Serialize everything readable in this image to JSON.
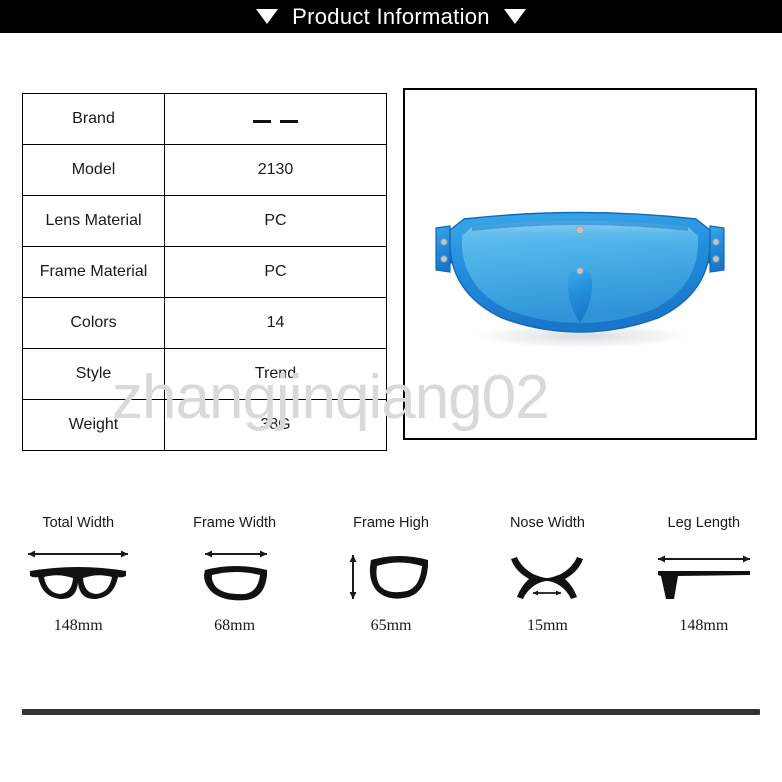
{
  "header": {
    "title": "Product Information",
    "left_marker": "triangle-down",
    "right_marker": "triangle-down",
    "background_color": "#000000",
    "text_color": "#ffffff"
  },
  "watermark": {
    "text": "zhangjinqiang02",
    "color": "#d9d9d9"
  },
  "spec_table": {
    "rows": [
      {
        "label": "Brand",
        "value": "— —",
        "value_is_dashes": true
      },
      {
        "label": "Model",
        "value": "2130",
        "value_is_dashes": false
      },
      {
        "label": "Lens Material",
        "value": "PC",
        "value_is_dashes": false
      },
      {
        "label": "Frame Material",
        "value": "PC",
        "value_is_dashes": false
      },
      {
        "label": "Colors",
        "value": "14",
        "value_is_dashes": false
      },
      {
        "label": "Style",
        "value": "Trend",
        "value_is_dashes": false
      },
      {
        "label": "Weight",
        "value": "38G",
        "value_is_dashes": false
      }
    ]
  },
  "product_image": {
    "alt": "blue shield sunglasses",
    "lens_color": "#4fb3e8",
    "lens_color_dark": "#2f93d8",
    "frame_color": "#1f7fd4",
    "frame_color_light": "#38a4e6",
    "rivet_color": "#b9c6cf"
  },
  "measurements": [
    {
      "label": "Total Width",
      "value": "148mm",
      "icon": "glasses-front-icon",
      "arrow": "horizontal"
    },
    {
      "label": "Frame Width",
      "value": "68mm",
      "icon": "single-lens-icon",
      "arrow": "horizontal"
    },
    {
      "label": "Frame High",
      "value": "65mm",
      "icon": "single-lens-height-icon",
      "arrow": "vertical"
    },
    {
      "label": "Nose Width",
      "value": "15mm",
      "icon": "nose-bridge-icon",
      "arrow": "horizontal"
    },
    {
      "label": "Leg Length",
      "value": "148mm",
      "icon": "temple-arm-icon",
      "arrow": "horizontal"
    }
  ],
  "divider": {
    "color": "#333333"
  }
}
